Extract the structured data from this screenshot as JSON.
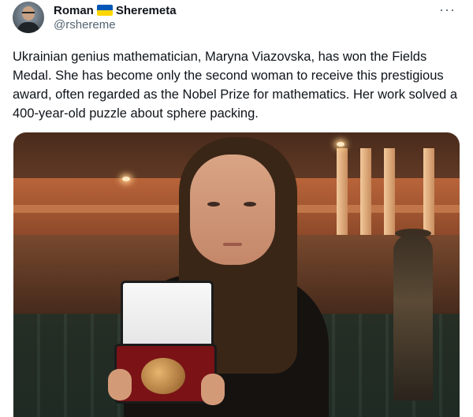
{
  "author": {
    "first_name": "Roman",
    "last_name": "Sheremeta",
    "handle": "@rshereme",
    "flag_icon": "ukraine-flag",
    "flag_colors": {
      "top": "#0057b7",
      "bottom": "#ffd700"
    }
  },
  "menu": {
    "more_label": "···"
  },
  "post": {
    "text": "Ukrainian genius mathematician, Maryna Viazovska, has won the Fields Medal. She has become only the second woman to receive this prestigious award, often regarded as the Nobel Prize for mathematics. Her work solved a 400-year-old puzzle about sphere packing."
  },
  "colors": {
    "text": "#0f1419",
    "secondary": "#536471",
    "background": "#ffffff"
  }
}
